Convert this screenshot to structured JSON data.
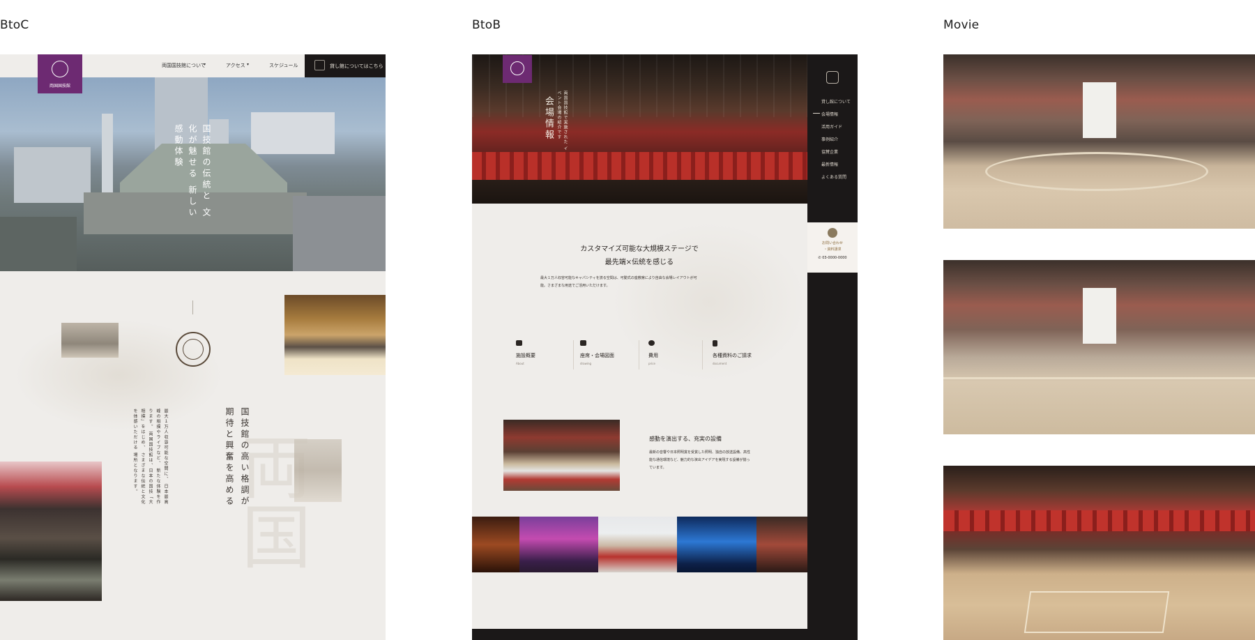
{
  "columns": {
    "btoc": "BtoC",
    "btob": "BtoB",
    "movie": "Movie"
  },
  "btoc": {
    "logo_text": "両国国技館",
    "nav": [
      {
        "label": "両国国技館について"
      },
      {
        "label": "アクセス"
      },
      {
        "label": "スケジュール"
      }
    ],
    "cta_label": "貸し館についてはこちら",
    "hero_copy": [
      "国技館の伝統と",
      "文化が魅せる",
      "新しい感動体験"
    ],
    "section_heading": [
      "国技館の高い格調が",
      "期待と興奮を高める"
    ],
    "section_body": [
      "最大１万人収容可能な空間に、",
      "日本最高峰の相撲やライブなど、",
      "新たな体験を作ります。",
      "両国国技館は、日本の国技「大相撲」をはじめ、",
      "さまざまな伝統と文化を体感いただける",
      "場所となります。"
    ],
    "bg_kanji": "両国"
  },
  "btob": {
    "hero_title": "会場情報",
    "hero_sub": [
      "両国国技館で実施された",
      "イベント会場の紹介です"
    ],
    "side_menu": [
      "貸し館について",
      "会場情報",
      "活用ガイド",
      "事例紹介",
      "協賛企業",
      "最新情報",
      "よくある質問"
    ],
    "contact": {
      "label1": "お問い合わせ",
      "label2": "・資料請求",
      "phone": "03-0000-0000"
    },
    "headline": [
      "カスタマイズ可能な大規模ステージで",
      "最先端×伝統を感じる"
    ],
    "body": [
      "最大１万人収容可能なキャパシティを誇る空間は、可動式の座敷席により自由な会場レイアウトが可",
      "能。さまざまな用途でご活用いただけます。"
    ],
    "features": [
      {
        "title": "施設概要",
        "sub": "About"
      },
      {
        "title": "座席・会場図面",
        "sub": "drawing"
      },
      {
        "title": "費用",
        "sub": "price"
      },
      {
        "title": "各種資料のご請求",
        "sub": "document"
      }
    ],
    "equip_title": "感動を演出する、充実の設備",
    "equip_body": [
      "最新の音響や日本照明賞を受賞した照明、独自の放送設備、高性",
      "能な通信環境など、魅力的な演出アイデアを実現する設備が揃っ",
      "ています。"
    ]
  },
  "colors": {
    "logo_purple": "#6d2a72",
    "dark": "#1b1818",
    "paper": "#efedea"
  }
}
